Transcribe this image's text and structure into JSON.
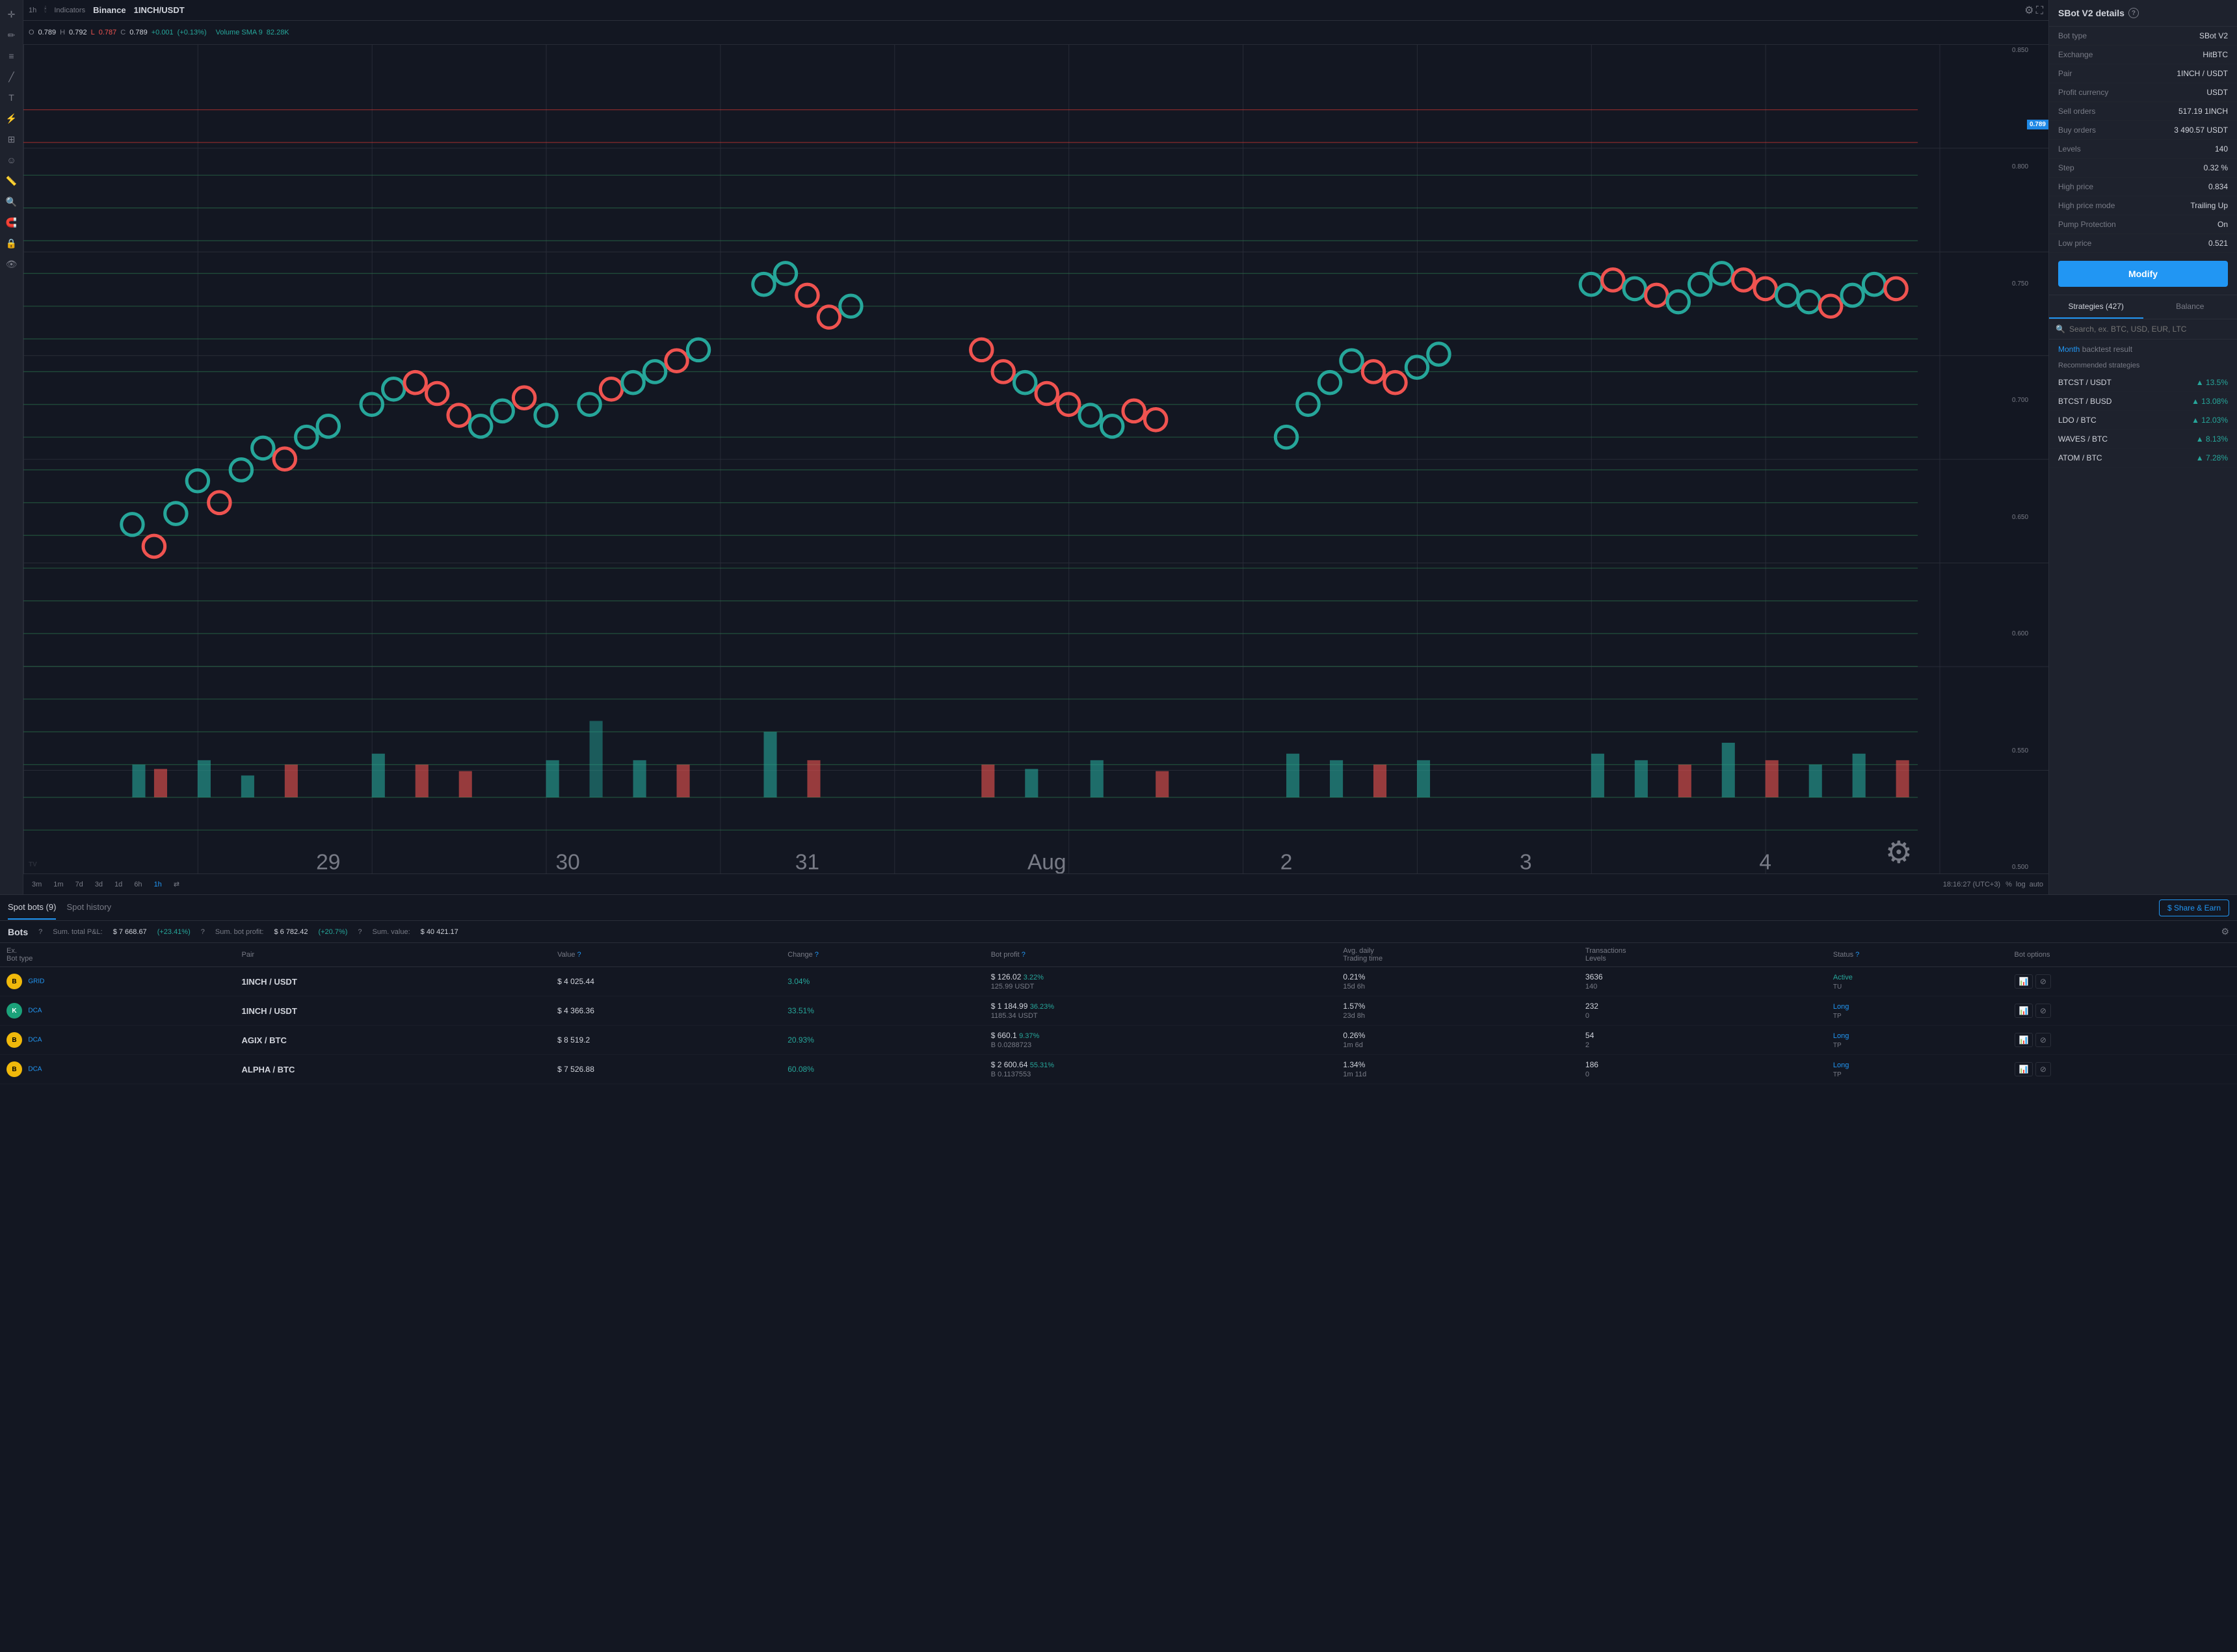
{
  "chart": {
    "timeframe": "1h",
    "indicators": "Indicators",
    "exchange": "Binance",
    "pair": "1INCH/USDT",
    "ohlc": {
      "open_label": "O",
      "open": "0.789",
      "high_label": "H",
      "high": "0.792",
      "low_label": "L",
      "low": "0.787",
      "close_label": "C",
      "close": "0.789",
      "change": "+0.001",
      "change_pct": "(+0.13%)"
    },
    "volume_label": "Volume SMA 9",
    "volume_value": "82.28K",
    "price_levels": [
      "0.850",
      "0.800",
      "0.750",
      "0.700",
      "0.650",
      "0.600",
      "0.550",
      "0.500"
    ],
    "current_price": "0.789",
    "time_display": "18:16:27 (UTC+3)",
    "timeframes": [
      "3m",
      "1m",
      "7d",
      "3d",
      "1d",
      "6h",
      "1h"
    ],
    "active_timeframe": "1h",
    "scale_options": [
      "%",
      "log",
      "auto"
    ],
    "x_labels": [
      "29",
      "30",
      "31",
      "Aug",
      "2",
      "3",
      "4"
    ]
  },
  "right_panel": {
    "title": "SBot V2 details",
    "bot_type_label": "Bot type",
    "bot_type_value": "SBot V2",
    "exchange_label": "Exchange",
    "exchange_value": "HitBTC",
    "pair_label": "Pair",
    "pair_value": "1INCH / USDT",
    "profit_currency_label": "Profit currency",
    "profit_currency_value": "USDT",
    "sell_orders_label": "Sell orders",
    "sell_orders_value": "517.19 1INCH",
    "buy_orders_label": "Buy orders",
    "buy_orders_value": "3 490.57 USDT",
    "levels_label": "Levels",
    "levels_value": "140",
    "step_label": "Step",
    "step_value": "0.32 %",
    "high_price_label": "High price",
    "high_price_value": "0.834",
    "high_price_mode_label": "High price mode",
    "high_price_mode_value": "Trailing Up",
    "pump_protection_label": "Pump Protection",
    "pump_protection_value": "On",
    "low_price_label": "Low price",
    "low_price_value": "0.521",
    "modify_btn": "Modify",
    "strategies_tab": "Strategies (427)",
    "balance_tab": "Balance",
    "search_placeholder": "Search, ex. BTC, USD, EUR, LTC",
    "backtest_month": "Month",
    "backtest_text": "backtest result",
    "recommended_label": "Recommended strategies",
    "strategies": [
      {
        "pair": "BTCST / USDT",
        "profit": "13.5%"
      },
      {
        "pair": "BTCST / BUSD",
        "profit": "13.08%"
      },
      {
        "pair": "LDO / BTC",
        "profit": "12.03%"
      },
      {
        "pair": "WAVES / BTC",
        "profit": "8.13%"
      },
      {
        "pair": "ATOM / BTC",
        "profit": "7.28%"
      }
    ]
  },
  "bottom_panel": {
    "tabs": [
      {
        "label": "Spot bots (9)",
        "active": true
      },
      {
        "label": "Spot history",
        "active": false
      }
    ],
    "share_earn_btn": "$ Share & Earn",
    "bots_title": "Bots",
    "stats": [
      {
        "label": "Sum. total P&L:",
        "value": "$ 7 668.67",
        "change": "(+23.41%)"
      },
      {
        "label": "Sum. bot profit:",
        "value": "$ 6 782.42",
        "change": "(+20.7%)"
      },
      {
        "label": "Sum. value:",
        "value": "$ 40 421.17"
      }
    ],
    "table_headers": {
      "ex": "Ex.",
      "pair_bot": "Pair\nBot type",
      "value": "Value",
      "change": "Change",
      "bot_profit": "Bot profit",
      "avg_daily": "Avg. daily\nTrading time",
      "transactions": "Transactions\nLevels",
      "status": "Status",
      "bot_options": "Bot options"
    },
    "bots": [
      {
        "exchange": "Binance",
        "exchange_abbr": "B",
        "exchange_class": "ex-binance",
        "pair": "1INCH / USDT",
        "bot_type": "GRID",
        "value": "$ 4 025.44",
        "change": "3.04%",
        "change_pos": true,
        "bot_profit": "$ 126.02",
        "bot_profit_pct": "3.22%",
        "bot_profit_sub": "125.99 USDT",
        "avg_daily": "0.21%",
        "trading_time": "15d 6h",
        "transactions": "3636",
        "levels": "140",
        "status": "Active",
        "status_sub": "TU",
        "status_class": "status-active"
      },
      {
        "exchange": "KuCoin",
        "exchange_abbr": "K",
        "exchange_class": "ex-kucoin",
        "pair": "1INCH / USDT",
        "bot_type": "DCA",
        "value": "$ 4 366.36",
        "change": "33.51%",
        "change_pos": true,
        "bot_profit": "$ 1 184.99",
        "bot_profit_pct": "36.23%",
        "bot_profit_sub": "1185.34 USDT",
        "avg_daily": "1.57%",
        "trading_time": "23d 8h",
        "transactions": "232",
        "levels": "0",
        "status": "Long",
        "status_sub": "TP",
        "status_class": "status-long"
      },
      {
        "exchange": "Binance",
        "exchange_abbr": "B",
        "exchange_class": "ex-binance",
        "pair": "AGIX / BTC",
        "bot_type": "DCA",
        "value": "$ 8 519.2",
        "change": "20.93%",
        "change_pos": true,
        "bot_profit": "$ 660.1",
        "bot_profit_pct": "9.37%",
        "bot_profit_sub": "B 0.0288723",
        "avg_daily": "0.26%",
        "trading_time": "1m 6d",
        "transactions": "54",
        "levels": "2",
        "status": "Long",
        "status_sub": "TP",
        "status_class": "status-long"
      },
      {
        "exchange": "Binance",
        "exchange_abbr": "B",
        "exchange_class": "ex-binance",
        "pair": "ALPHA / BTC",
        "bot_type": "DCA",
        "value": "$ 7 526.88",
        "change": "60.08%",
        "change_pos": true,
        "bot_profit": "$ 2 600.64",
        "bot_profit_pct": "55.31%",
        "bot_profit_sub": "B 0.1137553",
        "avg_daily": "1.34%",
        "trading_time": "1m 11d",
        "transactions": "186",
        "levels": "0",
        "status": "Long",
        "status_sub": "TP",
        "status_class": "status-long"
      }
    ]
  }
}
